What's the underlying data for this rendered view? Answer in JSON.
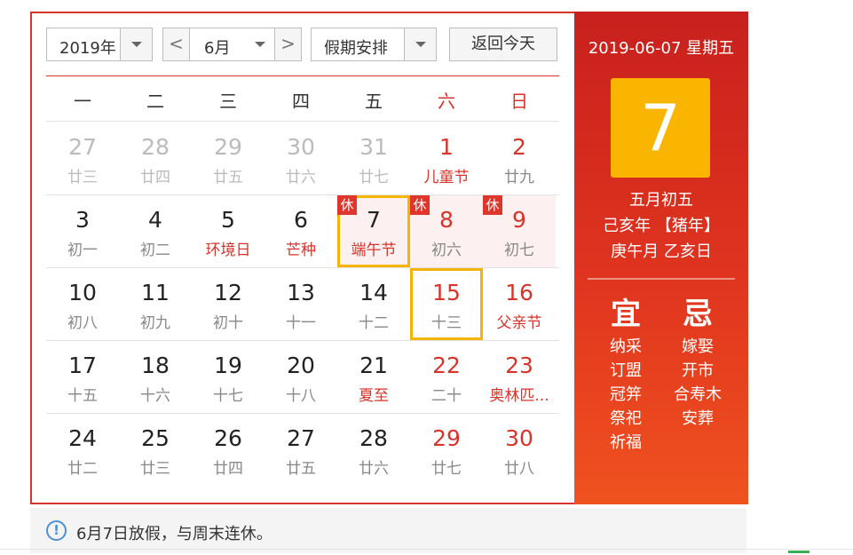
{
  "toolbar": {
    "year": "2019年",
    "prev": "<",
    "month": "6月",
    "next": ">",
    "holiday": "假期安排",
    "today_button": "返回今天"
  },
  "weekdays": [
    "一",
    "二",
    "三",
    "四",
    "五",
    "六",
    "日"
  ],
  "rest_badge": "休",
  "rows": [
    [
      {
        "n": "27",
        "s": "廿三"
      },
      {
        "n": "28",
        "s": "廿四"
      },
      {
        "n": "29",
        "s": "廿五"
      },
      {
        "n": "30",
        "s": "廿六"
      },
      {
        "n": "31",
        "s": "廿七"
      },
      {
        "n": "1",
        "s": "儿童节"
      },
      {
        "n": "2",
        "s": "廿九"
      }
    ],
    [
      {
        "n": "3",
        "s": "初一"
      },
      {
        "n": "4",
        "s": "初二"
      },
      {
        "n": "5",
        "s": "环境日"
      },
      {
        "n": "6",
        "s": "芒种"
      },
      {
        "n": "7",
        "s": "端午节"
      },
      {
        "n": "8",
        "s": "初六"
      },
      {
        "n": "9",
        "s": "初七"
      }
    ],
    [
      {
        "n": "10",
        "s": "初八"
      },
      {
        "n": "11",
        "s": "初九"
      },
      {
        "n": "12",
        "s": "初十"
      },
      {
        "n": "13",
        "s": "十一"
      },
      {
        "n": "14",
        "s": "十二"
      },
      {
        "n": "15",
        "s": "十三"
      },
      {
        "n": "16",
        "s": "父亲节"
      }
    ],
    [
      {
        "n": "17",
        "s": "十五"
      },
      {
        "n": "18",
        "s": "十六"
      },
      {
        "n": "19",
        "s": "十七"
      },
      {
        "n": "20",
        "s": "十八"
      },
      {
        "n": "21",
        "s": "夏至"
      },
      {
        "n": "22",
        "s": "二十"
      },
      {
        "n": "23",
        "s": "奥林匹..."
      }
    ],
    [
      {
        "n": "24",
        "s": "廿二"
      },
      {
        "n": "25",
        "s": "廿三"
      },
      {
        "n": "26",
        "s": "廿四"
      },
      {
        "n": "27",
        "s": "廿五"
      },
      {
        "n": "28",
        "s": "廿六"
      },
      {
        "n": "29",
        "s": "廿七"
      },
      {
        "n": "30",
        "s": "廿八"
      }
    ]
  ],
  "panel": {
    "date": "2019-06-07 星期五",
    "day": "7",
    "lunar_date": "五月初五",
    "year_ganzhi": "己亥年 【猪年】",
    "month_day_ganzhi": "庚午月 乙亥日",
    "yi_title": "宜",
    "yi_items": [
      "纳采",
      "订盟",
      "冠笄",
      "祭祀",
      "祈福"
    ],
    "ji_title": "忌",
    "ji_items": [
      "嫁娶",
      "开市",
      "合寿木",
      "安葬"
    ]
  },
  "note": {
    "icon": "!",
    "text": "6月7日放假，与周末连休。"
  },
  "colors": {
    "accent": "#d7342b",
    "highlight": "#f9b500",
    "info": "#4d90d8"
  }
}
